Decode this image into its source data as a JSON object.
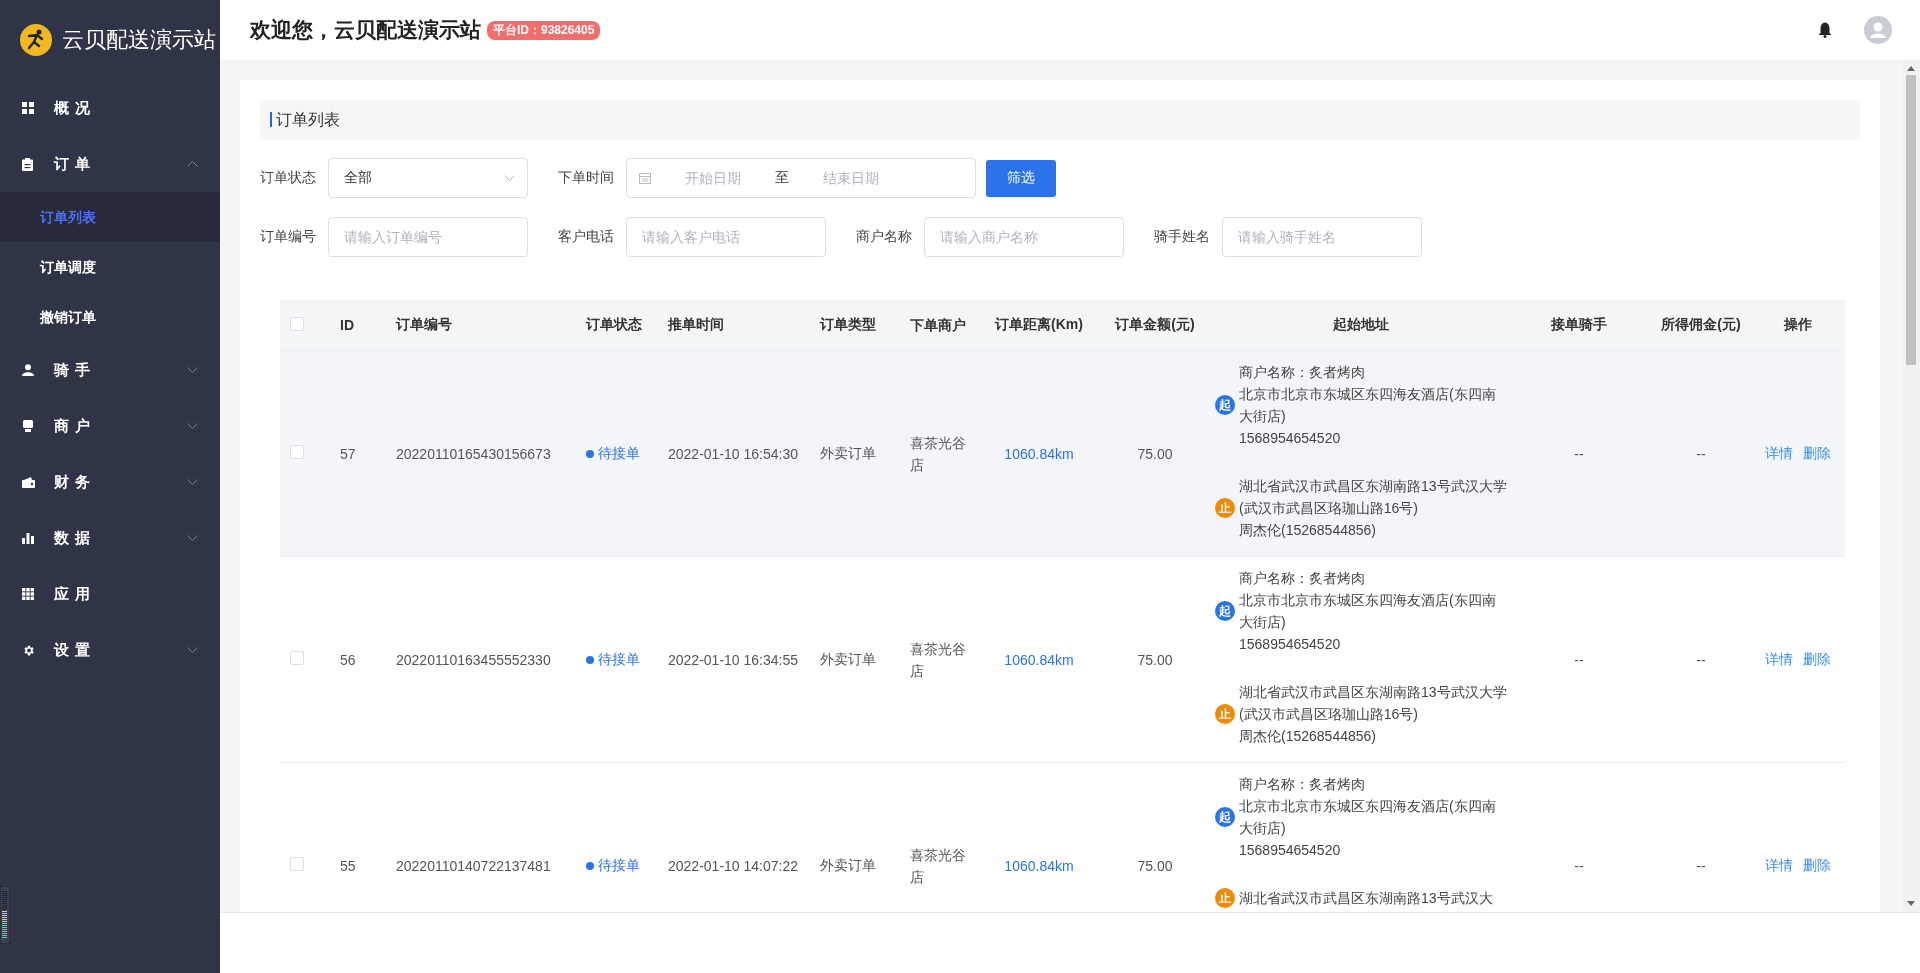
{
  "brand": {
    "name": "云贝配送演示站"
  },
  "sidebar": {
    "items": [
      {
        "label": "概况"
      },
      {
        "label": "订单",
        "expanded": true,
        "children": [
          {
            "label": "订单列表",
            "selected": true
          },
          {
            "label": "订单调度",
            "selected": false
          },
          {
            "label": "撤销订单",
            "selected": false
          }
        ]
      },
      {
        "label": "骑手",
        "expanded": false
      },
      {
        "label": "商户",
        "expanded": false
      },
      {
        "label": "财务",
        "expanded": false
      },
      {
        "label": "数据",
        "expanded": false
      },
      {
        "label": "应用"
      },
      {
        "label": "设置",
        "expanded": false
      }
    ]
  },
  "header": {
    "title": "欢迎您，云贝配送演示站",
    "badge": "平台ID：93826405"
  },
  "panel": {
    "title": "订单列表"
  },
  "filters": {
    "status": {
      "label": "订单状态",
      "value": "全部"
    },
    "time": {
      "label": "下单时间",
      "start_placeholder": "开始日期",
      "separator": "至",
      "end_placeholder": "结束日期"
    },
    "submit": "筛选",
    "fields": [
      {
        "label": "订单编号",
        "placeholder": "请输入订单编号"
      },
      {
        "label": "客户电话",
        "placeholder": "请输入客户电话"
      },
      {
        "label": "商户名称",
        "placeholder": "请输入商户名称"
      },
      {
        "label": "骑手姓名",
        "placeholder": "请输入骑手姓名"
      }
    ]
  },
  "table": {
    "select_all_checked": false,
    "columns": [
      "ID",
      "订单编号",
      "订单状态",
      "推单时间",
      "订单类型",
      "下单商户",
      "订单距离(Km)",
      "订单金额(元)",
      "起始地址",
      "接单骑手",
      "所得佣金(元)",
      "操作"
    ],
    "rows": [
      {
        "checked": false,
        "id": "57",
        "order_no": "20220110165430156673",
        "status": "待接单",
        "time": "2022-01-10 16:54:30",
        "type": "外卖订单",
        "merchant": "喜茶光谷店",
        "distance": "1060.84km",
        "amount": "75.00",
        "start_badge": "起",
        "start_merchant": "商户名称：炙者烤肉",
        "start_address": "北京市北京市东城区东四海友酒店(东四南大街店)",
        "start_phone": "1568954654520",
        "stop_badge": "止",
        "stop_address": "湖北省武汉市武昌区东湖南路13号武汉大学(武汉市武昌区珞珈山路16号)",
        "stop_contact": "周杰伦(15268544856)",
        "rider": "--",
        "commission": "--",
        "actions": [
          "详情",
          "删除"
        ]
      },
      {
        "checked": false,
        "id": "56",
        "order_no": "20220110163455552330",
        "status": "待接单",
        "time": "2022-01-10 16:34:55",
        "type": "外卖订单",
        "merchant": "喜茶光谷店",
        "distance": "1060.84km",
        "amount": "75.00",
        "start_badge": "起",
        "start_merchant": "商户名称：炙者烤肉",
        "start_address": "北京市北京市东城区东四海友酒店(东四南大街店)",
        "start_phone": "1568954654520",
        "stop_badge": "止",
        "stop_address": "湖北省武汉市武昌区东湖南路13号武汉大学(武汉市武昌区珞珈山路16号)",
        "stop_contact": "周杰伦(15268544856)",
        "rider": "--",
        "commission": "--",
        "actions": [
          "详情",
          "删除"
        ]
      },
      {
        "checked": false,
        "id": "55",
        "order_no": "20220110140722137481",
        "status": "待接单",
        "time": "2022-01-10 14:07:22",
        "type": "外卖订单",
        "merchant": "喜茶光谷店",
        "distance": "1060.84km",
        "amount": "75.00",
        "start_badge": "起",
        "start_merchant": "商户名称：炙者烤肉",
        "start_address": "北京市北京市东城区东四海友酒店(东四南大街店)",
        "start_phone": "1568954654520",
        "stop_badge": "止",
        "stop_address": "湖北省武汉市武昌区东湖南路13号武汉大",
        "rider": "--",
        "commission": "--",
        "actions": [
          "详情",
          "删除"
        ]
      }
    ]
  }
}
